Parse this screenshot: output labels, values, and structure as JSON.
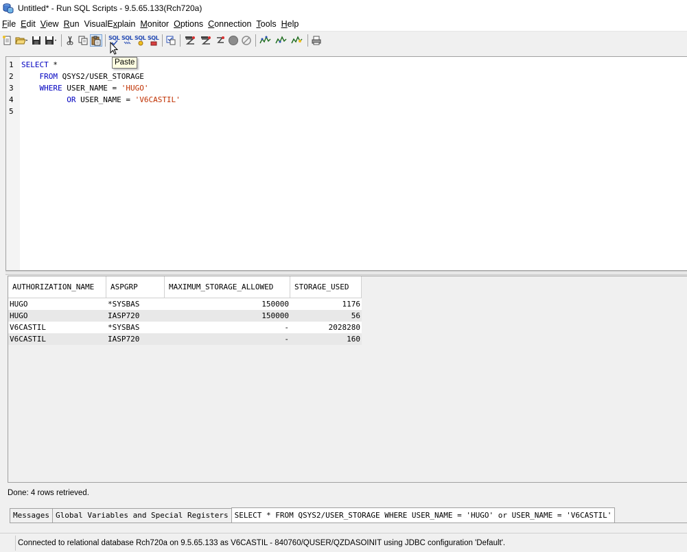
{
  "window": {
    "title": "Untitled* - Run SQL Scripts - 9.5.65.133(Rch720a)"
  },
  "menubar": {
    "items": [
      {
        "pre": "",
        "u": "F",
        "post": "ile"
      },
      {
        "pre": "",
        "u": "E",
        "post": "dit"
      },
      {
        "pre": "",
        "u": "V",
        "post": "iew"
      },
      {
        "pre": "",
        "u": "R",
        "post": "un"
      },
      {
        "pre": "VisualE",
        "u": "x",
        "post": "plain"
      },
      {
        "pre": "",
        "u": "M",
        "post": "onitor"
      },
      {
        "pre": "",
        "u": "O",
        "post": "ptions"
      },
      {
        "pre": "",
        "u": "C",
        "post": "onnection"
      },
      {
        "pre": "",
        "u": "T",
        "post": "ools"
      },
      {
        "pre": "",
        "u": "H",
        "post": "elp"
      }
    ]
  },
  "toolbar": {
    "sql_label": "SQL",
    "tooltip": "Paste"
  },
  "editor": {
    "lines": [
      {
        "num": "1",
        "indent": "",
        "tokens": [
          {
            "t": "kw",
            "v": "SELECT"
          },
          {
            "t": "plain",
            "v": " *"
          }
        ]
      },
      {
        "num": "2",
        "indent": "    ",
        "tokens": [
          {
            "t": "kw",
            "v": "FROM"
          },
          {
            "t": "plain",
            "v": " QSYS2/USER_STORAGE"
          }
        ]
      },
      {
        "num": "3",
        "indent": "    ",
        "tokens": [
          {
            "t": "kw",
            "v": "WHERE"
          },
          {
            "t": "plain",
            "v": " USER_NAME = "
          },
          {
            "t": "str",
            "v": "'HUGO'"
          }
        ]
      },
      {
        "num": "4",
        "indent": "          ",
        "tokens": [
          {
            "t": "kw",
            "v": "OR"
          },
          {
            "t": "plain",
            "v": " USER_NAME = "
          },
          {
            "t": "str",
            "v": "'V6CASTIL'"
          }
        ]
      },
      {
        "num": "5",
        "indent": "",
        "tokens": []
      }
    ]
  },
  "results": {
    "columns": [
      "AUTHORIZATION_NAME",
      "ASPGRP",
      "MAXIMUM_STORAGE_ALLOWED",
      "STORAGE_USED"
    ],
    "rows": [
      [
        "HUGO",
        "*SYSBAS",
        "150000",
        "1176"
      ],
      [
        "HUGO",
        "IASP720",
        "150000",
        "56"
      ],
      [
        "V6CASTIL",
        "*SYSBAS",
        "-",
        "2028280"
      ],
      [
        "V6CASTIL",
        "IASP720",
        "-",
        "160"
      ]
    ],
    "done_message": "Done: 4 rows retrieved."
  },
  "tabs": {
    "messages": "Messages",
    "global_vars": "Global Variables and Special Registers",
    "statement": "SELECT * FROM QSYS2/USER_STORAGE WHERE USER_NAME = 'HUGO' or USER_NAME = 'V6CASTIL'"
  },
  "statusbar": {
    "text": "Connected to relational database Rch720a on 9.5.65.133 as V6CASTIL - 840760/QUSER/QZDASOINIT using JDBC configuration 'Default'."
  }
}
